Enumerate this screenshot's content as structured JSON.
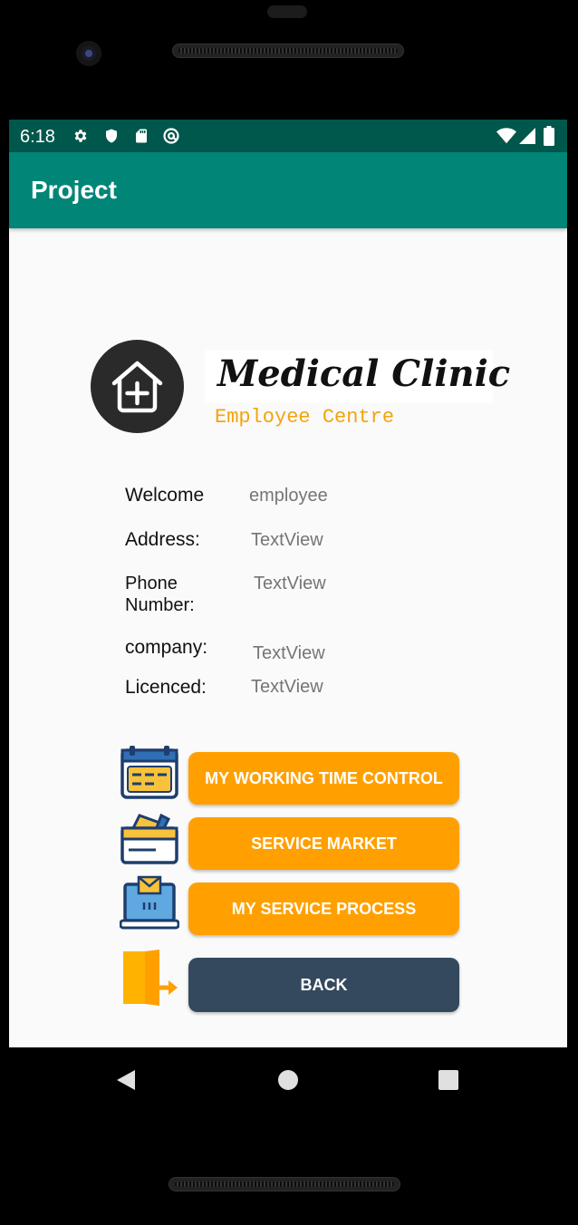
{
  "status_bar": {
    "time": "6:18",
    "left_icons": [
      "gear-icon",
      "shield-icon",
      "sd-card-icon",
      "at-sign-icon"
    ],
    "right_icons": [
      "wifi-icon",
      "signal-icon",
      "battery-icon"
    ]
  },
  "app_bar": {
    "title": "Project"
  },
  "header": {
    "brand_name": "Medical Clinic",
    "brand_subtitle": "Employee Centre",
    "logo_icon": "house-plus-icon"
  },
  "info": {
    "welcome_label": "Welcome",
    "welcome_value": "employee",
    "address_label": "Address:",
    "address_value": "TextView",
    "phone_label_line1": "Phone",
    "phone_label_line2": "Number:",
    "phone_value": "TextView",
    "company_label": "company:",
    "company_value": "TextView",
    "licenced_label": "Licenced:",
    "licenced_value": "TextView"
  },
  "actions": {
    "working_time_label": "MY WORKING TIME CONTROL",
    "service_market_label": "SERVICE MARKET",
    "service_process_label": "MY SERVICE PROCESS",
    "back_label": "BACK"
  },
  "colors": {
    "status_bar": "#00574b",
    "app_bar": "#008577",
    "accent_orange": "#ffa000",
    "back_button": "#34495e",
    "subtitle": "#f5a30b"
  }
}
